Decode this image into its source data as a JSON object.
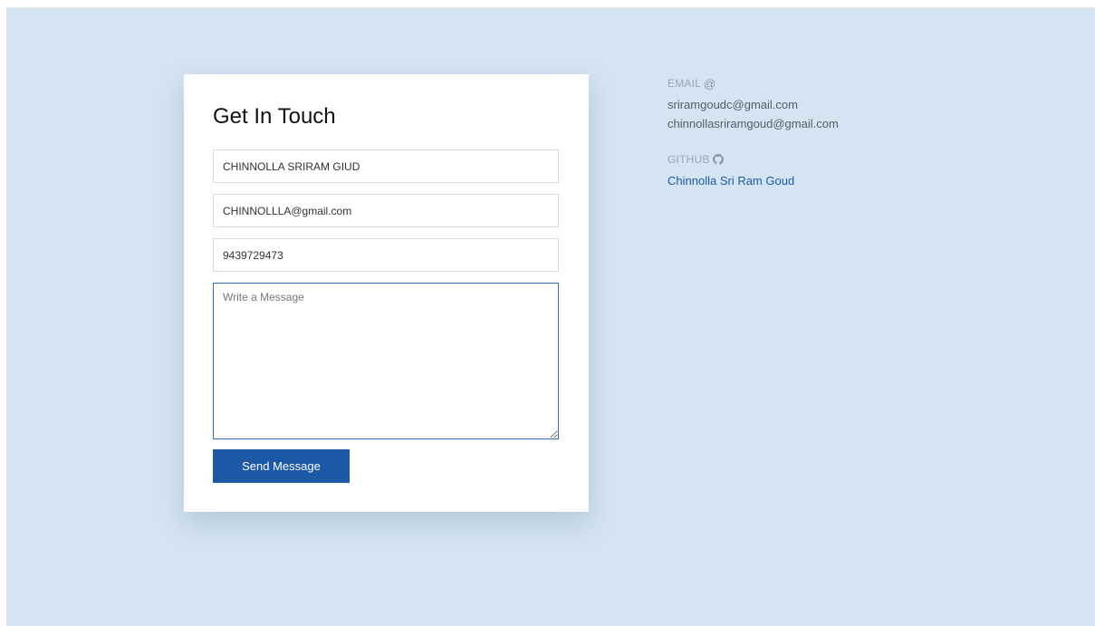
{
  "contact_form": {
    "title": "Get In Touch",
    "name_value": "CHINNOLLA SRIRAM GIUD",
    "email_value": "CHINNOLLLA@gmail.com",
    "phone_value": "9439729473",
    "message_placeholder": "Write a Message",
    "send_label": "Send Message"
  },
  "contact_info": {
    "email_label": "EMAIL",
    "email_symbol": "@",
    "emails": [
      "sriramgoudc@gmail.com",
      "chinnollasriramgoud@gmail.com"
    ],
    "github_label": "GITHUB",
    "github_icon": "github-icon",
    "github_link": "Chinnolla Sri Ram Goud"
  },
  "colors": {
    "background": "#d4e4f2",
    "accent": "#1b58a6"
  }
}
